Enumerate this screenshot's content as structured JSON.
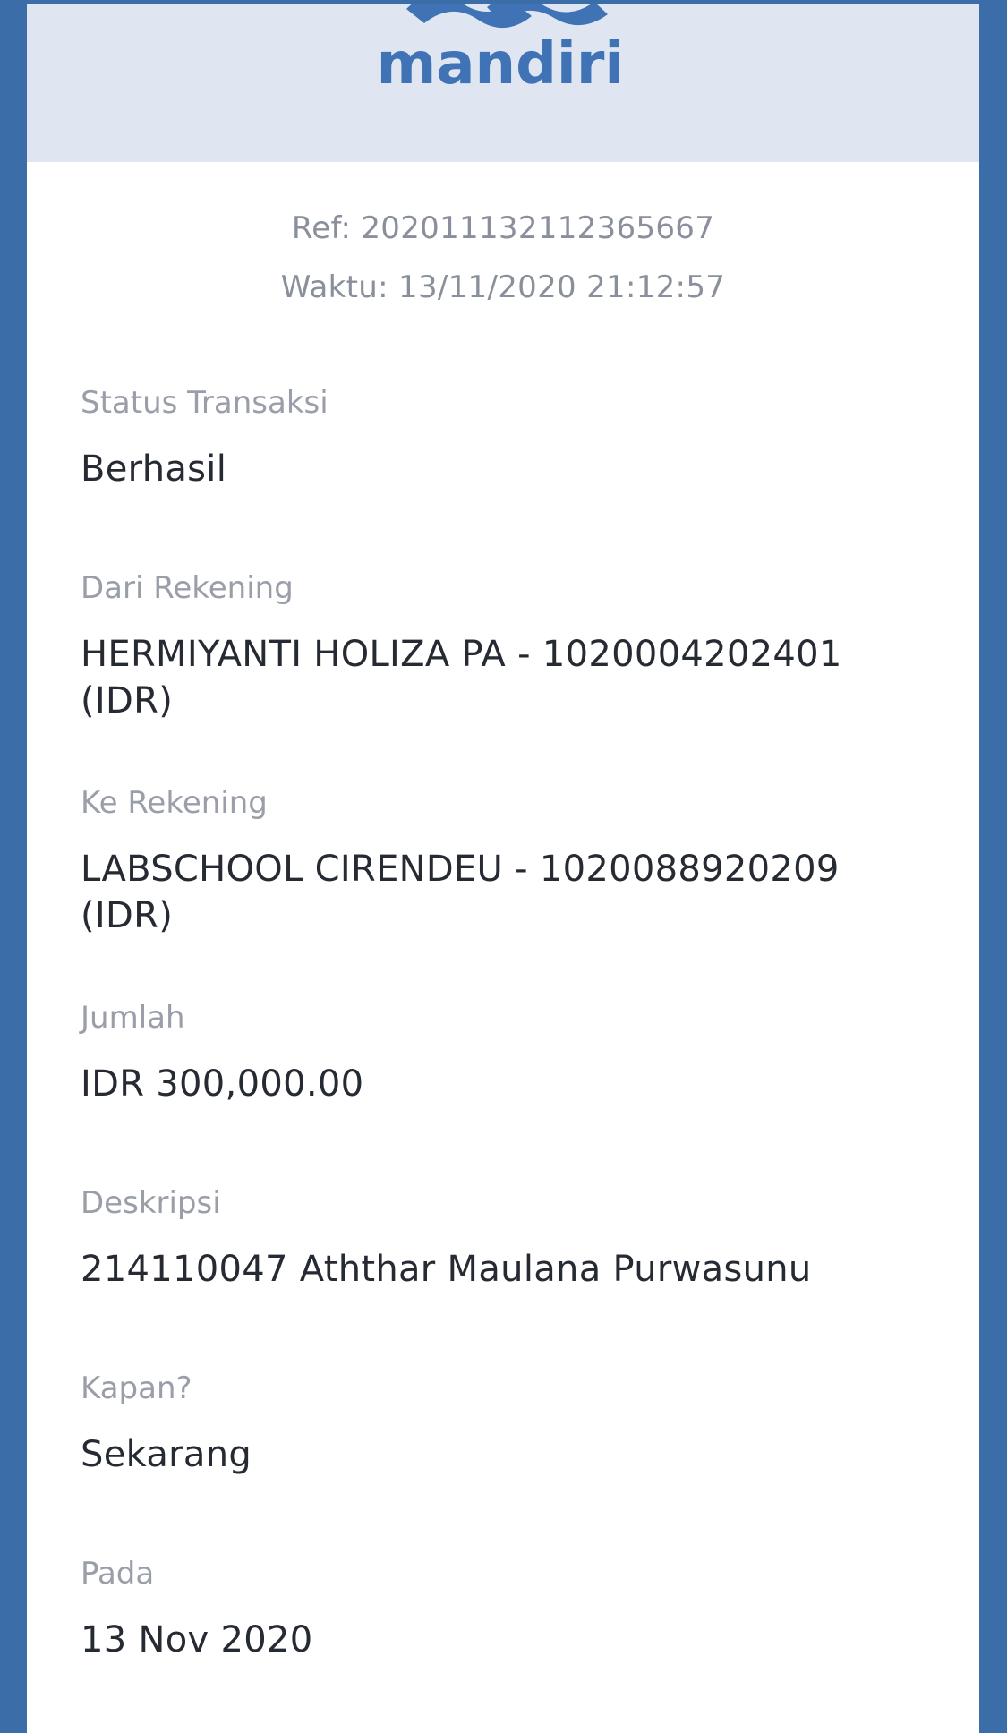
{
  "header": {
    "logo_text": "mandiri"
  },
  "transaction": {
    "ref": "Ref: 202011132112365667",
    "time": "Waktu: 13/11/2020 21:12:57"
  },
  "fields": [
    {
      "label": "Status Transaksi",
      "value": "Berhasil"
    },
    {
      "label": "Dari Rekening",
      "value": "HERMIYANTI HOLIZA PA - 1020004202401 (IDR)"
    },
    {
      "label": "Ke Rekening",
      "value": "LABSCHOOL CIRENDEU - 1020088920209 (IDR)"
    },
    {
      "label": "Jumlah",
      "value": "IDR 300,000.00"
    },
    {
      "label": "Deskripsi",
      "value": "214110047 Aththar Maulana Purwasunu"
    },
    {
      "label": "Kapan?",
      "value": "Sekarang"
    },
    {
      "label": "Pada",
      "value": "13 Nov 2020"
    }
  ],
  "colors": {
    "brand_blue": "#3b6ea8",
    "header_bg": "#dfe6f1",
    "label_gray": "#9a9ea9",
    "value_dark": "#262a33"
  }
}
